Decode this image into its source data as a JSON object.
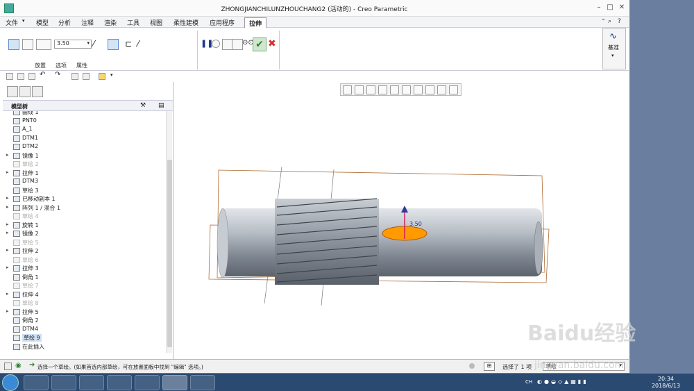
{
  "window": {
    "title": "ZHONGJIANCHILUNZHOUCHANG2 (活动的) - Creo Parametric"
  },
  "menu": {
    "items": [
      "文件",
      "模型",
      "分析",
      "注释",
      "渲染",
      "工具",
      "视图",
      "柔性建模",
      "应用程序"
    ],
    "active_tab": "拉伸"
  },
  "ribbon": {
    "depth_value": "3.50",
    "tabs": [
      "放置",
      "选项",
      "属性"
    ],
    "datum_label": "基准"
  },
  "left_panel": {
    "header": "模型树",
    "items": [
      {
        "label": "曲线 1",
        "dim": false
      },
      {
        "label": "PNT0",
        "dim": false
      },
      {
        "label": "A_1",
        "dim": false
      },
      {
        "label": "DTM1",
        "dim": false
      },
      {
        "label": "DTM2",
        "dim": false
      },
      {
        "label": "镜像 1",
        "dim": false,
        "expand": true
      },
      {
        "label": "草绘 2",
        "dim": true
      },
      {
        "label": "拉伸 1",
        "dim": false,
        "expand": true
      },
      {
        "label": "DTM3",
        "dim": false
      },
      {
        "label": "草绘 3",
        "dim": false
      },
      {
        "label": "已移动副本 1",
        "dim": false,
        "expand": true
      },
      {
        "label": "阵列 1 / 混合 1",
        "dim": false,
        "expand": true
      },
      {
        "label": "草绘 4",
        "dim": true
      },
      {
        "label": "旋转 1",
        "dim": false,
        "expand": true
      },
      {
        "label": "镜像 2",
        "dim": false,
        "expand": true
      },
      {
        "label": "草绘 5",
        "dim": true
      },
      {
        "label": "拉伸 2",
        "dim": false,
        "expand": true
      },
      {
        "label": "草绘 6",
        "dim": true
      },
      {
        "label": "拉伸 3",
        "dim": false,
        "expand": true
      },
      {
        "label": "倒角 1",
        "dim": false
      },
      {
        "label": "草绘 7",
        "dim": true
      },
      {
        "label": "拉伸 4",
        "dim": false,
        "expand": true
      },
      {
        "label": "草绘 8",
        "dim": true
      },
      {
        "label": "拉伸 5",
        "dim": false,
        "expand": true
      },
      {
        "label": "倒角 2",
        "dim": false
      },
      {
        "label": "DTM4",
        "dim": false
      },
      {
        "label": "草绘 9",
        "dim": false,
        "highlight": true
      },
      {
        "label": "在此插入",
        "dim": false
      }
    ]
  },
  "model": {
    "dimension_label": "3.50"
  },
  "status": {
    "message": "选择一个草绘。(如果首选内部草绘，可在放置面板中找到 \"编辑\" 选项。)",
    "selection": "选择了 1 项",
    "filter": "草绘"
  },
  "taskbar": {
    "time": "20:34",
    "date": "2018/6/13",
    "lang": "CH"
  },
  "watermark": {
    "brand": "Baidu经验",
    "url": "jingyan.baidu.com"
  },
  "colors": {
    "accent": "#2f7d32",
    "cancel": "#d32f2f",
    "highlight": "#ff9a00"
  }
}
